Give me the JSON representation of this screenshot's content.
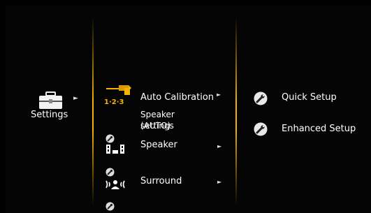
{
  "category": {
    "label": "Settings",
    "icon": "toolbox-icon"
  },
  "menu": {
    "items": [
      {
        "label": "Auto Calibration",
        "icon": "auto-calibration-icon",
        "badge": "1·2·3",
        "selected": true
      },
      {
        "label": "Speaker",
        "icon": "speaker-layout-icon"
      },
      {
        "label": "Surround",
        "icon": "surround-icon"
      }
    ],
    "selected_description_line1": "Speaker settings",
    "selected_description_line2": "(AUTO)"
  },
  "submenu": {
    "items": [
      {
        "label": "Quick Setup",
        "icon": "wrench-icon"
      },
      {
        "label": "Enhanced Setup",
        "icon": "wrench-icon"
      }
    ]
  },
  "colors": {
    "accent": "#f2b400",
    "background": "#050505"
  }
}
